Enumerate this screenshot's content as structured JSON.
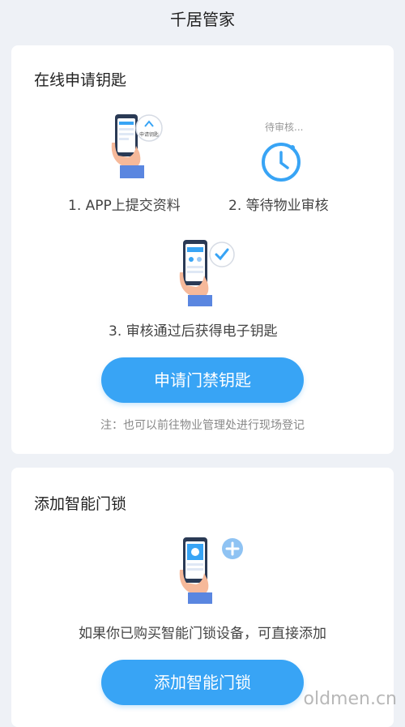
{
  "header": {
    "title": "千居管家"
  },
  "apply_card": {
    "title": "在线申请钥匙",
    "steps": [
      {
        "label": "1. APP上提交资料",
        "phone_text": "申请钥匙"
      },
      {
        "label": "2. 等待物业审核",
        "status_text": "待审核..."
      },
      {
        "label": "3. 审核通过后获得电子钥匙"
      }
    ],
    "button_label": "申请门禁钥匙",
    "note": "注：也可以前往物业管理处进行现场登记"
  },
  "lock_card": {
    "title": "添加智能门锁",
    "description": "如果你已购买智能门锁设备，可直接添加",
    "button_label": "添加智能门锁"
  },
  "watermark": "oldmen.cn",
  "colors": {
    "accent": "#38a4f5",
    "page_bg": "#eef1f6",
    "card_bg": "#ffffff",
    "skin": "#f6b99a",
    "sleeve": "#5a86e0",
    "phone_dark": "#2a3a55"
  }
}
